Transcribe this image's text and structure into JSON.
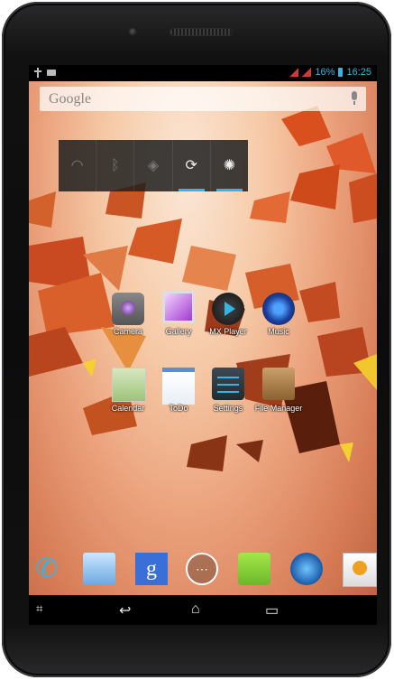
{
  "statusbar": {
    "battery_percent": "16%",
    "time": "16:25"
  },
  "search": {
    "logo": "Google"
  },
  "widget": {
    "toggles": [
      {
        "name": "wifi",
        "icon": "wifi-icon",
        "on": false
      },
      {
        "name": "bluetooth",
        "icon": "bluetooth-icon",
        "on": false
      },
      {
        "name": "gps",
        "icon": "gps-icon",
        "on": false
      },
      {
        "name": "sync",
        "icon": "sync-icon",
        "on": true
      },
      {
        "name": "brightness",
        "icon": "brightness-icon",
        "on": true
      }
    ]
  },
  "apps": {
    "row1": [
      "Camera",
      "Gallery",
      "MX Player",
      "Music"
    ],
    "row2": [
      "Calendar",
      "ToDo",
      "Settings",
      "File Manager"
    ]
  },
  "dock": {
    "items": [
      "phone-icon",
      "contacts-icon",
      "google-search-icon",
      "app-drawer-icon",
      "messaging-icon",
      "browser-icon",
      "email-icon"
    ]
  },
  "navbar": {
    "items": [
      "screenshot-icon",
      "back-icon",
      "home-icon",
      "recent-apps-icon"
    ]
  }
}
